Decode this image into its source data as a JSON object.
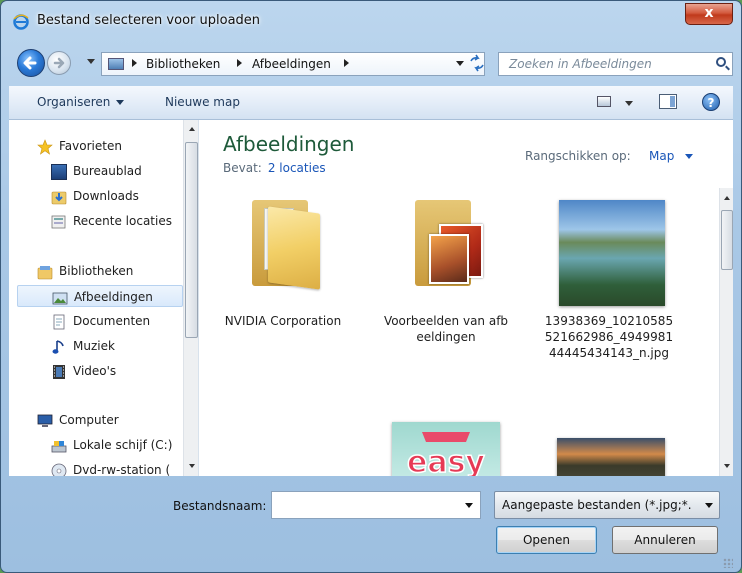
{
  "window": {
    "title": "Bestand selecteren voor uploaden",
    "close_label": "x"
  },
  "address": {
    "crumbs": [
      "Bibliotheken",
      "Afbeeldingen"
    ]
  },
  "search": {
    "placeholder": "Zoeken in Afbeeldingen"
  },
  "toolbar": {
    "organize_label": "Organiseren",
    "new_folder_label": "Nieuwe map",
    "help_label": "?"
  },
  "navpane": {
    "favorites_header": "Favorieten",
    "favorites": [
      "Bureaublad",
      "Downloads",
      "Recente locaties"
    ],
    "libraries_header": "Bibliotheken",
    "libraries": [
      "Afbeeldingen",
      "Documenten",
      "Muziek",
      "Video's"
    ],
    "computer_header": "Computer",
    "drives": [
      "Lokale schijf (C:)",
      "Dvd-rw-station ("
    ],
    "selected": "Afbeeldingen"
  },
  "content": {
    "library_title": "Afbeeldingen",
    "includes_label": "Bevat:",
    "locations_link": "2 locaties",
    "arrange_label": "Rangschikken op:",
    "arrange_value": "Map",
    "items": [
      {
        "caption": "NVIDIA Corporation",
        "type": "folder"
      },
      {
        "caption": "Voorbeelden van afbeeldingen",
        "type": "folder"
      },
      {
        "caption": "13938369_10210585521662986_494998144445434143_n.jpg",
        "type": "photo"
      }
    ],
    "row2_image_text": "Take it easy"
  },
  "bottom": {
    "filename_label": "Bestandsnaam:",
    "filename_value": "",
    "filter_value": "Aangepaste bestanden (*.jpg;*.",
    "open_label": "Openen",
    "cancel_label": "Annuleren"
  },
  "colors": {
    "link": "#1a56b8",
    "library_title": "#1e5a3a",
    "chrome": "#a9c8e6"
  }
}
